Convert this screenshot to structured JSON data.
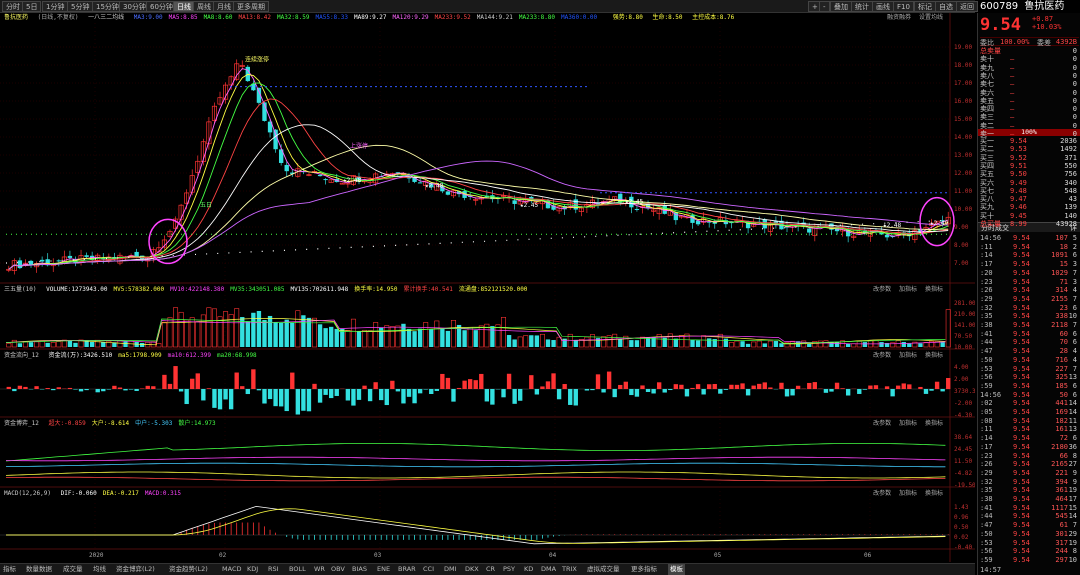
{
  "toolbar": {
    "buttons": [
      "分时",
      "5日",
      "1分钟",
      "5分钟",
      "15分钟",
      "30分钟",
      "60分钟",
      "日线",
      "周线",
      "月线",
      "更多周期"
    ],
    "active": "日线",
    "right_buttons": [
      "+",
      "-",
      "叠加",
      "统计",
      "画线",
      "F10",
      "标记",
      "自选",
      "返回"
    ]
  },
  "main_header": {
    "name": "鲁抗医药",
    "adjust": "(日线,不复权)",
    "indicator": "一八三二均线",
    "ma_items": [
      {
        "label": "MA3:9.00",
        "color": "#4a6cff"
      },
      {
        "label": "MA5:8.85",
        "color": "#ff44ff"
      },
      {
        "label": "MA8:8.60",
        "color": "#44ff44"
      },
      {
        "label": "MA13:8.42",
        "color": "#ff4444"
      },
      {
        "label": "MA32:8.59",
        "color": "#44ff44"
      },
      {
        "label": "MA55:8.33",
        "color": "#2255ff"
      },
      {
        "label": "MA89:9.27",
        "color": "#ffffff"
      },
      {
        "label": "MA120:9.29",
        "color": "#ff66ff"
      },
      {
        "label": "MA233:9.52",
        "color": "#ff4444"
      },
      {
        "label": "MA144:9.21",
        "color": "#cccccc"
      },
      {
        "label": "MA233:8.80",
        "color": "#44ff44"
      },
      {
        "label": "MA360:0.00",
        "color": "#2255ff"
      }
    ],
    "signals": {
      "strong": "强势:8.80",
      "life": "生命:8.50",
      "main": "主控成本:8.76"
    },
    "tools": [
      "融资融券",
      "设置均线"
    ]
  },
  "price_axis": [
    "19.00",
    "18.00",
    "17.00",
    "16.00",
    "15.00",
    "14.00",
    "13.00",
    "12.00",
    "11.00",
    "10.00",
    "9.00",
    "8.00",
    "7.00"
  ],
  "annotations": [
    {
      "text": "连续涨停",
      "color": "#ffff66"
    },
    {
      "text": "上涨停",
      "color": "#ff66ff"
    },
    {
      "text": "五日",
      "color": "#66ff66"
    },
    {
      "text": "★2.48",
      "color": "#ffffff"
    },
    {
      "text": "★2.48",
      "color": "#ffffff"
    },
    {
      "text": "★2.45",
      "color": "#ffffff"
    },
    {
      "text": "★2.45",
      "color": "#ffffff"
    },
    {
      "text": "★2.48",
      "color": "#ffffff"
    },
    {
      "text": "★2.49",
      "color": "#ffffff"
    }
  ],
  "volume_panel": {
    "title": "三五量(10)",
    "items": [
      {
        "label": "VOLUME:1273943.00",
        "color": "#ffffff"
      },
      {
        "label": "MV5:578382.000",
        "color": "#ffff44"
      },
      {
        "label": "MV10:422148.380",
        "color": "#ff44ff"
      },
      {
        "label": "MV35:343051.085",
        "color": "#44ff44"
      },
      {
        "label": "MV135:702611.948",
        "color": "#ffffff"
      },
      {
        "label": "换手率:14.950",
        "color": "#ffff44"
      },
      {
        "label": "累计换手:40.541",
        "color": "#ff4444"
      },
      {
        "label": "流通盘:852121520.000",
        "color": "#ffff44"
      }
    ],
    "axis": [
      "281.00",
      "210.00",
      "141.00",
      "70.50",
      "10.00"
    ],
    "tools": [
      "改参数",
      "加指标",
      "换指标"
    ]
  },
  "flow_panel": {
    "title": "资金流向_12",
    "items": [
      {
        "label": "资金流(万):3426.510",
        "color": "#ffffff"
      },
      {
        "label": "ma5:1798.909",
        "color": "#ffff44"
      },
      {
        "label": "ma10:612.399",
        "color": "#ff44ff"
      },
      {
        "label": "ma20:68.998",
        "color": "#44ff44"
      }
    ],
    "axis": [
      "4.00",
      "2.00",
      "3730.31",
      "-2.00",
      "-4.30"
    ],
    "tools": [
      "改参数",
      "加指标",
      "换指标"
    ]
  },
  "trend_panel": {
    "title": "资金博弈_12",
    "items": [
      {
        "label": "超大:-0.859",
        "color": "#ff4444"
      },
      {
        "label": "大户:-8.614",
        "color": "#ffff44"
      },
      {
        "label": "中户:-5.303",
        "color": "#44ccff"
      },
      {
        "label": "散户:14.973",
        "color": "#44ff44"
      }
    ],
    "axis": [
      "38.64",
      "24.45",
      "11.50",
      "-4.82",
      "-19.50"
    ],
    "tools": [
      "改参数",
      "加指标",
      "换指标"
    ]
  },
  "macd_panel": {
    "title": "MACD(12,26,9)",
    "items": [
      {
        "label": "DIF:-0.060",
        "color": "#ffffff"
      },
      {
        "label": "DEA:-0.217",
        "color": "#ffff44"
      },
      {
        "label": "MACD:0.315",
        "color": "#ff44ff"
      }
    ],
    "axis": [
      "1.43",
      "0.96",
      "0.50",
      "0.02",
      "-0.40"
    ],
    "tools": [
      "改参数",
      "加指标",
      "换指标"
    ]
  },
  "x_axis": [
    "2020",
    "02",
    "03",
    "04",
    "05",
    "06"
  ],
  "bottom_tabs": [
    "指标",
    "数量数据",
    "成交量",
    "均线",
    "资金博弈(L2)",
    "资金趋势(L2)",
    "MACD",
    "KDJ",
    "RSI",
    "BOLL",
    "WR",
    "OBV",
    "BIAS",
    "ENE",
    "BRAR",
    "CCI",
    "DMI",
    "DKX",
    "CR",
    "PSY",
    "KD",
    "DMA",
    "TRIX",
    "虚拟成交量",
    "更多指标",
    "模板"
  ],
  "bottom_active": "模板",
  "stock": {
    "code": "600789",
    "name": "鲁抗医药",
    "price": "9.54",
    "change": "+0.87",
    "change_pct": "+10.03%",
    "webi_label": "委比",
    "webi": "100.00%",
    "wecha_label": "委差",
    "wecha": "4392B"
  },
  "sell_orders": [
    {
      "label": "总卖量",
      "price": "",
      "vol": "0"
    },
    {
      "label": "卖十",
      "price": "—",
      "vol": "0"
    },
    {
      "label": "卖九",
      "price": "—",
      "vol": "0"
    },
    {
      "label": "卖八",
      "price": "—",
      "vol": "0"
    },
    {
      "label": "卖七",
      "price": "—",
      "vol": "0"
    },
    {
      "label": "卖六",
      "price": "—",
      "vol": "0"
    },
    {
      "label": "卖五",
      "price": "—",
      "vol": "0"
    },
    {
      "label": "卖四",
      "price": "—",
      "vol": "0"
    },
    {
      "label": "卖三",
      "price": "—",
      "vol": "0"
    },
    {
      "label": "卖二",
      "price": "—",
      "vol": "0"
    },
    {
      "label": "卖一",
      "price": "—",
      "vol": "0"
    }
  ],
  "mid_pct": "100%",
  "buy_orders": [
    {
      "label": "买一",
      "price": "9.54",
      "vol": "2036"
    },
    {
      "label": "买二",
      "price": "9.53",
      "vol": "1492"
    },
    {
      "label": "买三",
      "price": "9.52",
      "vol": "371"
    },
    {
      "label": "买四",
      "price": "9.51",
      "vol": "550"
    },
    {
      "label": "买五",
      "price": "9.50",
      "vol": "756"
    },
    {
      "label": "买六",
      "price": "9.49",
      "vol": "340"
    },
    {
      "label": "买七",
      "price": "9.48",
      "vol": "548"
    },
    {
      "label": "买八",
      "price": "9.47",
      "vol": "43"
    },
    {
      "label": "买九",
      "price": "9.46",
      "vol": "139"
    },
    {
      "label": "买十",
      "price": "9.45",
      "vol": "140"
    },
    {
      "label": "总买量",
      "price": "8.99",
      "vol": "43928"
    }
  ],
  "trades_title": "分时成交",
  "trades_expand": "详",
  "trades": [
    {
      "t": "14:56",
      "p": "9.54",
      "v": "107",
      "n": "5"
    },
    {
      "t": ":11",
      "p": "9.54",
      "v": "18",
      "n": "2"
    },
    {
      "t": ":14",
      "p": "9.54",
      "v": "1091",
      "n": "6"
    },
    {
      "t": ":17",
      "p": "9.54",
      "v": "15",
      "n": "3"
    },
    {
      "t": ":20",
      "p": "9.54",
      "v": "1029",
      "n": "7"
    },
    {
      "t": ":23",
      "p": "9.54",
      "v": "71",
      "n": "3"
    },
    {
      "t": ":26",
      "p": "9.54",
      "v": "314",
      "n": "4"
    },
    {
      "t": ":29",
      "p": "9.54",
      "v": "2155",
      "n": "7"
    },
    {
      "t": ":32",
      "p": "9.54",
      "v": "23",
      "n": "6"
    },
    {
      "t": ":35",
      "p": "9.54",
      "v": "338",
      "n": "10"
    },
    {
      "t": ":38",
      "p": "9.54",
      "v": "2118",
      "n": "7"
    },
    {
      "t": ":41",
      "p": "9.54",
      "v": "60",
      "n": "6"
    },
    {
      "t": ":44",
      "p": "9.54",
      "v": "70",
      "n": "6"
    },
    {
      "t": ":47",
      "p": "9.54",
      "v": "28",
      "n": "4"
    },
    {
      "t": ":50",
      "p": "9.54",
      "v": "716",
      "n": "4"
    },
    {
      "t": ":53",
      "p": "9.54",
      "v": "227",
      "n": "7"
    },
    {
      "t": ":56",
      "p": "9.54",
      "v": "325",
      "n": "13"
    },
    {
      "t": ":59",
      "p": "9.54",
      "v": "185",
      "n": "6"
    },
    {
      "t": "14:56",
      "p": "9.54",
      "v": "50",
      "n": "6"
    },
    {
      "t": ":02",
      "p": "9.54",
      "v": "441",
      "n": "14"
    },
    {
      "t": ":05",
      "p": "9.54",
      "v": "169",
      "n": "14"
    },
    {
      "t": ":08",
      "p": "9.54",
      "v": "182",
      "n": "11"
    },
    {
      "t": ":11",
      "p": "9.54",
      "v": "161",
      "n": "13"
    },
    {
      "t": ":14",
      "p": "9.54",
      "v": "72",
      "n": "6"
    },
    {
      "t": ":17",
      "p": "9.54",
      "v": "2180",
      "n": "36"
    },
    {
      "t": ":23",
      "p": "9.54",
      "v": "66",
      "n": "8"
    },
    {
      "t": ":26",
      "p": "9.54",
      "v": "2165",
      "n": "27"
    },
    {
      "t": ":29",
      "p": "9.54",
      "v": "221",
      "n": "9"
    },
    {
      "t": ":32",
      "p": "9.54",
      "v": "394",
      "n": "9"
    },
    {
      "t": ":35",
      "p": "9.54",
      "v": "361",
      "n": "19"
    },
    {
      "t": ":38",
      "p": "9.54",
      "v": "464",
      "n": "17"
    },
    {
      "t": ":41",
      "p": "9.54",
      "v": "1117",
      "n": "15"
    },
    {
      "t": ":44",
      "p": "9.54",
      "v": "545",
      "n": "14"
    },
    {
      "t": ":47",
      "p": "9.54",
      "v": "61",
      "n": "7"
    },
    {
      "t": ":50",
      "p": "9.54",
      "v": "301",
      "n": "29"
    },
    {
      "t": ":53",
      "p": "9.54",
      "v": "317",
      "n": "19"
    },
    {
      "t": ":56",
      "p": "9.54",
      "v": "244",
      "n": "8"
    },
    {
      "t": ":59",
      "p": "9.54",
      "v": "297",
      "n": "10"
    }
  ],
  "last_trade_time": "14:57",
  "colors": {
    "up": "#ff3333",
    "down": "#33e0e0",
    "bg": "#000000",
    "grid": "#3a0000"
  }
}
